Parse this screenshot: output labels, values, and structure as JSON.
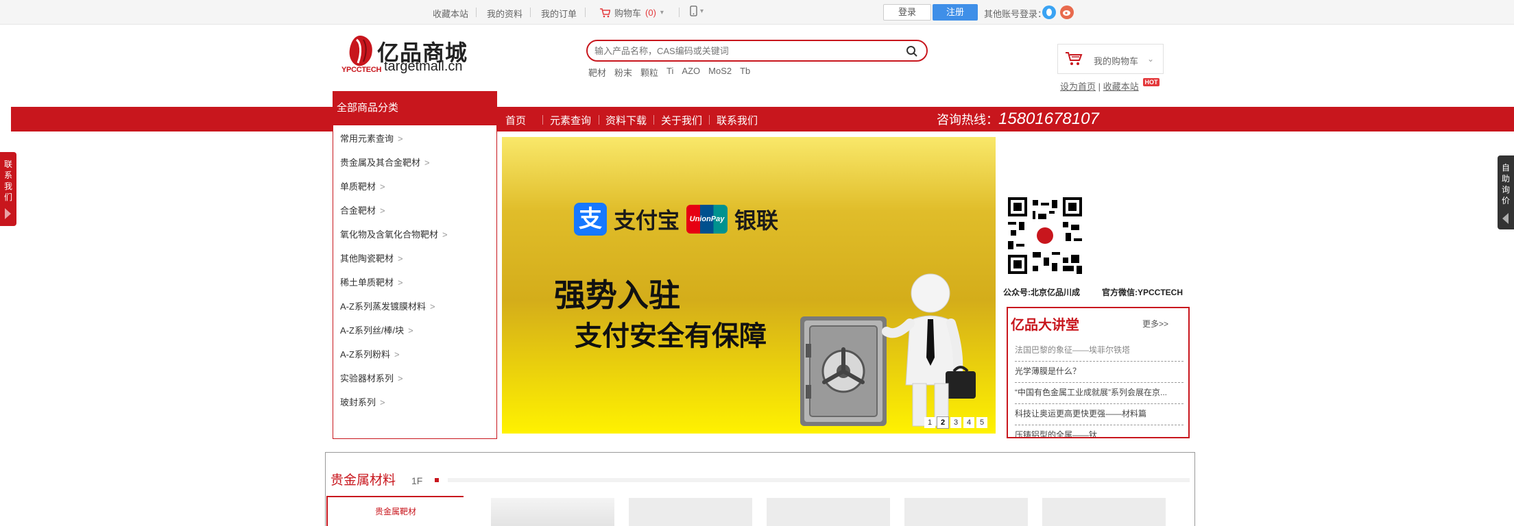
{
  "topbar": {
    "links": [
      "收藏本站",
      "我的资料",
      "我的订单"
    ],
    "cart_label": "购物车",
    "cart_count": "(0)",
    "login": "登录",
    "register": "注册",
    "other_login": "其他账号登录："
  },
  "header": {
    "logo_cn": "亿品商城",
    "logo_en": "targetmall.cn",
    "logo_brand": "YPCCTECH",
    "search_placeholder": "输入产品名称，CAS编码或关键词",
    "hot_words": [
      "靶材",
      "粉末",
      "颗粒",
      "Ti",
      "AZO",
      "MoS2",
      "Tb"
    ],
    "my_cart": "我的购物车",
    "set_home": "设为首页",
    "set_sep": "|",
    "bookmark": "收藏本站",
    "hot_badge": "HOT"
  },
  "nav": {
    "all_categories": "全部商品分类",
    "items": [
      "首页",
      "元素查询",
      "资料下载",
      "关于我们",
      "联系我们"
    ],
    "hotline_label": "咨询热线：",
    "hotline_number": "15801678107"
  },
  "categories": [
    "常用元素查询",
    "贵金属及其合金靶材",
    "单质靶材",
    "合金靶材",
    "氧化物及含氧化合物靶材",
    "其他陶瓷靶材",
    "稀土单质靶材",
    "A-Z系列蒸发镀膜材料",
    "A-Z系列丝/棒/块",
    "A-Z系列粉料",
    "实验器材系列",
    "玻封系列"
  ],
  "banner": {
    "alipay_symbol": "支",
    "alipay": "支付宝",
    "unionpay_badge": "UnionPay",
    "unionpay": "银联",
    "slogan1": "强势入驻",
    "slogan2": "支付安全有保障",
    "dots": [
      "1",
      "2",
      "3",
      "4",
      "5"
    ],
    "active_dot": 2
  },
  "qr": {
    "caption_public": "公众号:北京亿品川成",
    "caption_wechat": "官方微信:YPCCTECH"
  },
  "lecture": {
    "title": "亿品大讲堂",
    "more": "更多>>",
    "items": [
      "法国巴黎的象征——埃菲尔铁塔",
      "光学薄膜是什么？",
      "“中国有色金属工业成就展”系列会展在京...",
      "科技让奥运更高更快更强——材料篇",
      "压铸铝型的全属——钛"
    ]
  },
  "side": {
    "left_text": "联系我们",
    "right_text": "自助询价"
  },
  "floor": {
    "title": "贵金属材料",
    "number": "1F",
    "tab": "贵金属靶材"
  },
  "colors": {
    "brand_red": "#c8161d",
    "register_blue": "#3f8fe8",
    "qq_blue": "#3aa3f3",
    "weibo_orange": "#e86a4d"
  }
}
